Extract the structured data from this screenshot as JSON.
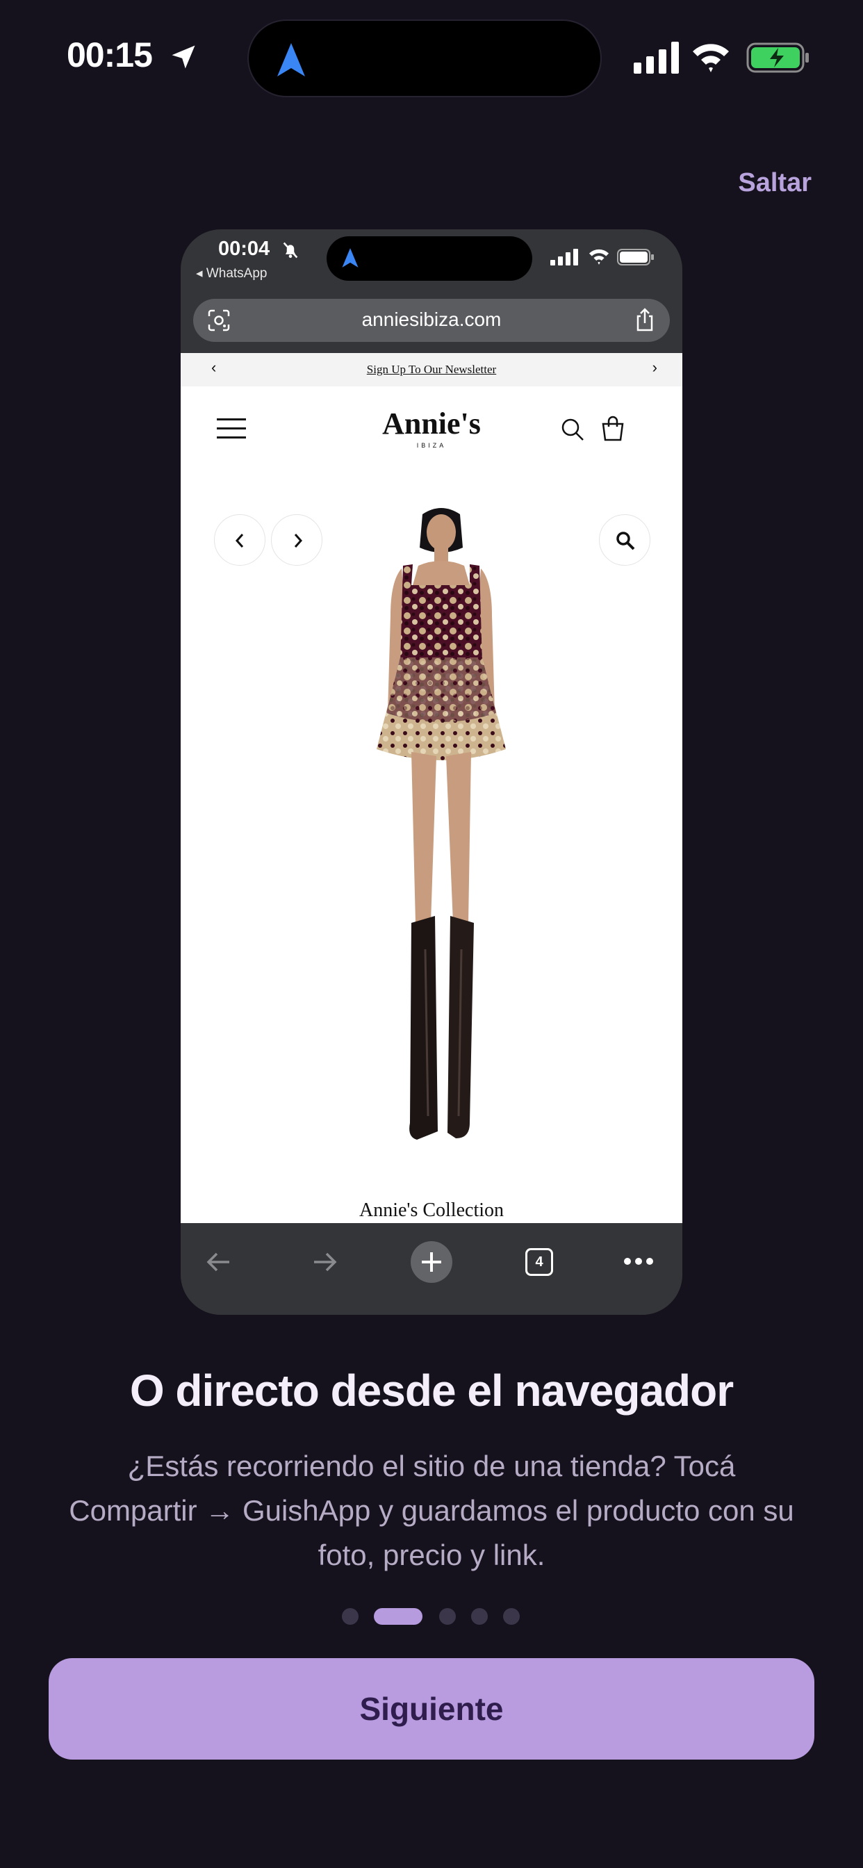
{
  "status_bar": {
    "time": "00:15"
  },
  "skip_label": "Saltar",
  "phone": {
    "time": "00:04",
    "back_app": "◂ WhatsApp",
    "url": "anniesibiza.com",
    "tab_count": "4",
    "website": {
      "newsletter_prev": "‹",
      "newsletter_text": "Sign Up To Our Newsletter",
      "newsletter_next": "›",
      "brand": "Annie's",
      "brand_sub": "IBIZA",
      "collection_title": "Annie's Collection"
    }
  },
  "onboarding": {
    "title": "O directo desde el navegador",
    "description": "¿Estás recorriendo el sitio de una tienda? Tocá Compartir → GuishApp y guardamos el producto con su foto, precio y link.",
    "current_step": 2,
    "total_steps": 5
  },
  "cta_label": "Siguiente",
  "colors": {
    "background": "#15121e",
    "accent": "#b89cdf",
    "accent_text": "#2f1e4d",
    "nav_blue": "#3a86f5"
  }
}
